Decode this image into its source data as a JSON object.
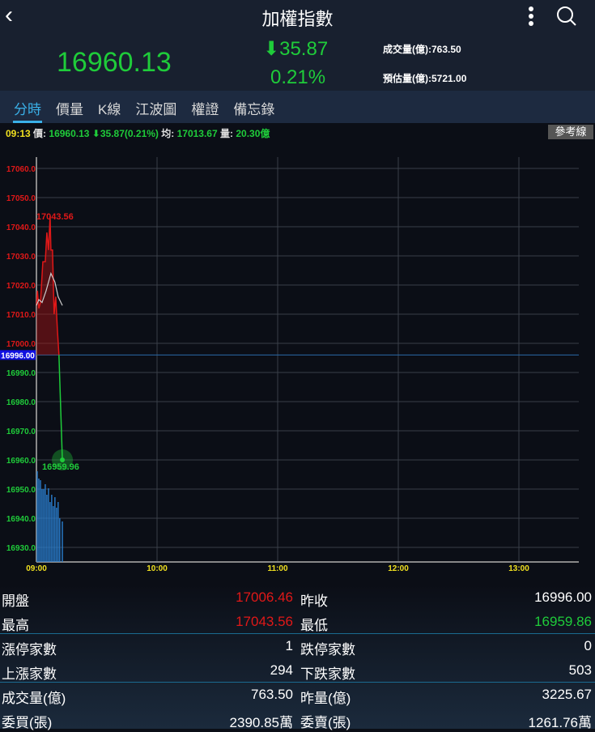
{
  "nav": {
    "title": "加權指數",
    "back_icon": "chevron-left-icon",
    "more_icon": "more-vertical-icon",
    "search_icon": "search-icon"
  },
  "quote": {
    "last": "16960.13",
    "change": "35.87",
    "change_pct": "0.21%",
    "volume": "成交量(億):763.50",
    "estimated": "預估量(億):5721.00"
  },
  "tabs": [
    "分時",
    "價量",
    "K線",
    "江波圖",
    "權證",
    "備忘錄"
  ],
  "infobar": {
    "time": "09:13",
    "price_label": "價:",
    "price": "16960.13",
    "change": "35.87(0.21%)",
    "avg_label": "均:",
    "avg": "17013.67",
    "vol_label": "量:",
    "vol": "20.30",
    "vol_unit": "億",
    "ref_button": "參考線"
  },
  "colors": {
    "up": "#e01818",
    "down": "#1fcc3a",
    "accent": "#3ab0e8",
    "avg": "#cccccc",
    "volume": "#2a7fd0"
  },
  "chart_data": {
    "type": "line",
    "title": "分時",
    "x_ticks": [
      "09:00",
      "10:00",
      "11:00",
      "12:00",
      "13:00"
    ],
    "x_range_minutes": [
      0,
      274
    ],
    "y_ticks": [
      17060,
      17050,
      17040,
      17030,
      17020,
      17010,
      17000,
      16990,
      16980,
      16970,
      16960,
      16950,
      16940,
      16930
    ],
    "y_range": [
      16925,
      17060
    ],
    "reference": {
      "value": 16996.0,
      "label": "16996.00"
    },
    "high_label": "17043.56",
    "last_label": "16959.96",
    "price": [
      [
        0,
        17013
      ],
      [
        0.5,
        17018
      ],
      [
        1.2,
        17012
      ],
      [
        2,
        17014
      ],
      [
        3.2,
        17028
      ],
      [
        4.4,
        17028
      ],
      [
        5.2,
        17038
      ],
      [
        6,
        17032
      ],
      [
        6.8,
        17043.56
      ],
      [
        7.2,
        17032
      ],
      [
        8,
        17032
      ],
      [
        8.8,
        17010
      ],
      [
        9.6,
        17016
      ],
      [
        10.4,
        17005
      ],
      [
        11.2,
        16996
      ],
      [
        12.9,
        16960
      ]
    ],
    "average": [
      [
        0,
        17013
      ],
      [
        1.2,
        17015
      ],
      [
        2.8,
        17014
      ],
      [
        4.8,
        17018
      ],
      [
        7.2,
        17024
      ],
      [
        9.2,
        17021
      ],
      [
        10.8,
        17016
      ],
      [
        12.9,
        17013
      ]
    ],
    "volume": [
      [
        0.4,
        112
      ],
      [
        1.2,
        103
      ],
      [
        2,
        101
      ],
      [
        2.8,
        90
      ],
      [
        3.6,
        90
      ],
      [
        4.4,
        96
      ],
      [
        5.2,
        83
      ],
      [
        6,
        91
      ],
      [
        6.8,
        74
      ],
      [
        7.6,
        83
      ],
      [
        8.4,
        69
      ],
      [
        9.2,
        80
      ],
      [
        10,
        67
      ],
      [
        10.8,
        74
      ],
      [
        11.6,
        54
      ],
      [
        12.9,
        50
      ]
    ]
  },
  "stats": [
    {
      "l1": "開盤",
      "v1": "17006.46",
      "c1": "red",
      "l2": "昨收",
      "v2": "16996.00",
      "c2": ""
    },
    {
      "l1": "最高",
      "v1": "17043.56",
      "c1": "red",
      "l2": "最低",
      "v2": "16959.86",
      "c2": "grn"
    },
    {
      "l1": "漲停家數",
      "v1": "1",
      "c1": "",
      "l2": "跌停家數",
      "v2": "0",
      "c2": ""
    },
    {
      "l1": "上漲家數",
      "v1": "294",
      "c1": "",
      "l2": "下跌家數",
      "v2": "503",
      "c2": ""
    },
    {
      "l1": "成交量(億)",
      "v1": "763.50",
      "c1": "",
      "l2": "昨量(億)",
      "v2": "3225.67",
      "c2": ""
    },
    {
      "l1": "委買(張)",
      "v1": "2390.85萬",
      "c1": "",
      "l2": "委賣(張)",
      "v2": "1261.76萬",
      "c2": ""
    }
  ]
}
